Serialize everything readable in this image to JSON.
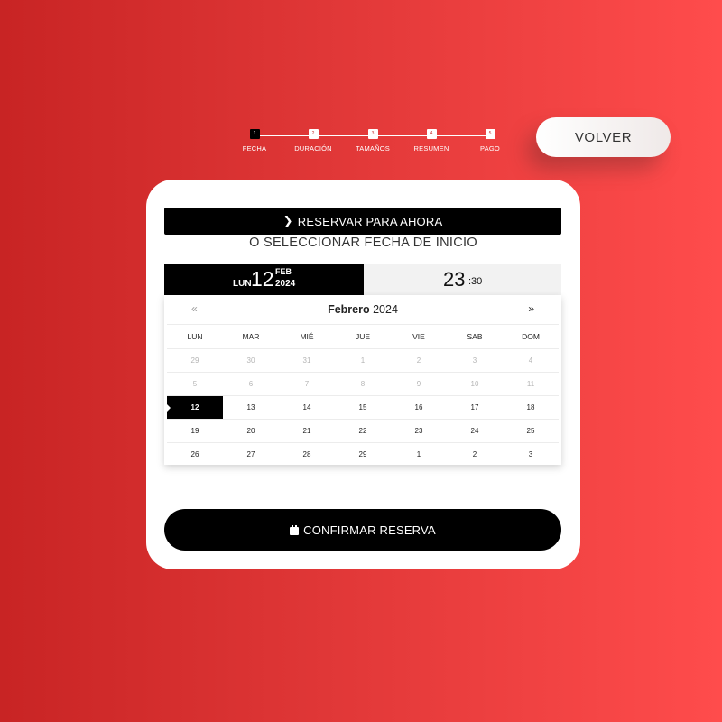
{
  "stepper": {
    "steps": [
      {
        "number": "1",
        "label": "FECHA",
        "active": true
      },
      {
        "number": "2",
        "label": "DURACIÓN",
        "active": false
      },
      {
        "number": "3",
        "label": "TAMAÑOS",
        "active": false
      },
      {
        "number": "4",
        "label": "RESUMEN",
        "active": false
      },
      {
        "number": "5",
        "label": "PAGO",
        "active": false
      }
    ]
  },
  "back_button": {
    "label": "VOLVER"
  },
  "booking": {
    "now_button": {
      "label": "RESERVAR PARA AHORA",
      "icon": "chevron-right-icon"
    },
    "or_label": "O SELECCIONAR FECHA DE INICIO",
    "selected_date": {
      "weekday": "LUN",
      "day": "12",
      "month": "FEB",
      "year": "2024"
    },
    "selected_time": {
      "hour": "23",
      "minute": ":30"
    },
    "calendar": {
      "prev": "«",
      "next": "»",
      "month_name": "Febrero",
      "year": "2024",
      "weekdays": [
        "LUN",
        "MAR",
        "MIÉ",
        "JUE",
        "VIE",
        "SAB",
        "DOM"
      ],
      "weeks": [
        [
          {
            "d": "29",
            "muted": true
          },
          {
            "d": "30",
            "muted": true
          },
          {
            "d": "31",
            "muted": true
          },
          {
            "d": "1",
            "muted": true
          },
          {
            "d": "2",
            "muted": true
          },
          {
            "d": "3",
            "muted": true
          },
          {
            "d": "4",
            "muted": true
          }
        ],
        [
          {
            "d": "5",
            "muted": true
          },
          {
            "d": "6",
            "muted": true
          },
          {
            "d": "7",
            "muted": true
          },
          {
            "d": "8",
            "muted": true
          },
          {
            "d": "9",
            "muted": true
          },
          {
            "d": "10",
            "muted": true
          },
          {
            "d": "11",
            "muted": true
          }
        ],
        [
          {
            "d": "12",
            "selected": true
          },
          {
            "d": "13"
          },
          {
            "d": "14"
          },
          {
            "d": "15"
          },
          {
            "d": "16"
          },
          {
            "d": "17"
          },
          {
            "d": "18"
          }
        ],
        [
          {
            "d": "19"
          },
          {
            "d": "20"
          },
          {
            "d": "21"
          },
          {
            "d": "22"
          },
          {
            "d": "23"
          },
          {
            "d": "24"
          },
          {
            "d": "25"
          }
        ],
        [
          {
            "d": "26"
          },
          {
            "d": "27"
          },
          {
            "d": "28"
          },
          {
            "d": "29"
          },
          {
            "d": "1"
          },
          {
            "d": "2"
          },
          {
            "d": "3"
          }
        ]
      ]
    },
    "confirm_button": {
      "label": "CONFIRMAR RESERVA",
      "icon": "calendar-icon"
    }
  },
  "colors": {
    "accent": "#000000",
    "background_start": "#c82424",
    "background_end": "#ff4c4c",
    "card": "#ffffff"
  }
}
